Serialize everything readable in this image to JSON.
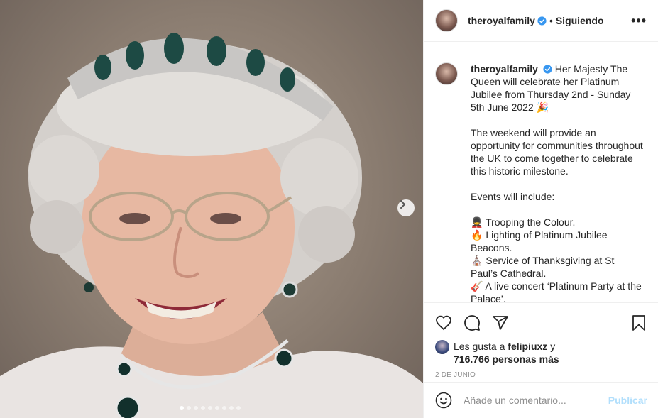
{
  "post": {
    "username": "theroyalfamily",
    "follow_separator": "•",
    "follow_label": "Siguiendo",
    "more_label": "•••",
    "caption_user": "theroyalfamily",
    "caption_lines": [
      "Her Majesty The Queen will celebrate her Platinum Jubilee from Thursday 2nd - Sunday 5th June 2022 🎉",
      "The weekend will provide an opportunity for communities throughout the UK to come together to celebrate this historic milestone.",
      "Events will include:",
      "💂 Trooping the Colour.\n🔥 Lighting of Platinum Jubilee Beacons.\n⛪ Service of Thanksgiving at St Paul’s Cathedral.\n🎸 A live concert ‘Platinum Party at the Palace’."
    ],
    "likes_prefix": "Les gusta a",
    "likes_user": "felipiuxz",
    "likes_joiner": "y",
    "likes_count": "716.766 personas más",
    "date": "2 DE JUNIO",
    "comment_placeholder": "Añade un comentario...",
    "publish_label": "Publicar"
  },
  "carousel": {
    "total_slides": 9,
    "active_index": 0
  },
  "icons": {
    "like": "heart-icon",
    "comment": "comment-bubble-icon",
    "share": "paper-plane-icon",
    "save": "bookmark-icon",
    "next": "chevron-right-icon",
    "emoji": "smiley-icon",
    "verified": "verified-badge-icon"
  },
  "colors": {
    "verified": "#3897f0",
    "publish_disabled": "#b2dffc",
    "secondary_text": "#8e8e8e"
  }
}
